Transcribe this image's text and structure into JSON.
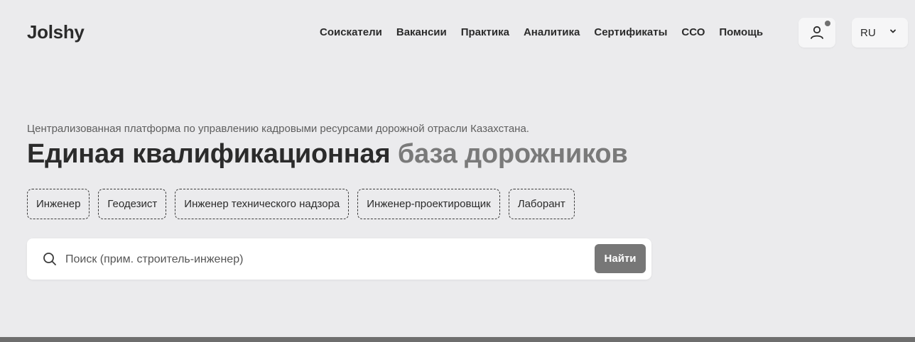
{
  "header": {
    "logo": "Jolshy",
    "nav": [
      "Соискатели",
      "Вакансии",
      "Практика",
      "Аналитика",
      "Сертификаты",
      "ССО",
      "Помощь"
    ],
    "language": "RU",
    "user_icon": "user-icon",
    "notification_indicator": "notification-dot"
  },
  "hero": {
    "subtitle": "Централизованная платформа по управлению кадровыми ресурсами дорожной отрасли Казахстана.",
    "title_dark": "Единая квалификационная",
    "title_light": "база дорожников",
    "tags": [
      "Инженер",
      "Геодезист",
      "Инженер технического надзора",
      "Инженер-проектировщик",
      "Лаборант"
    ]
  },
  "search": {
    "placeholder": "Поиск (прим. строитель-инженер)",
    "value": "",
    "button_label": "Найти",
    "icon": "search-icon"
  },
  "colors": {
    "background": "#ebebed",
    "text": "#2b2b2b",
    "accent_text": "#7a7a7a",
    "button": "#777777"
  }
}
